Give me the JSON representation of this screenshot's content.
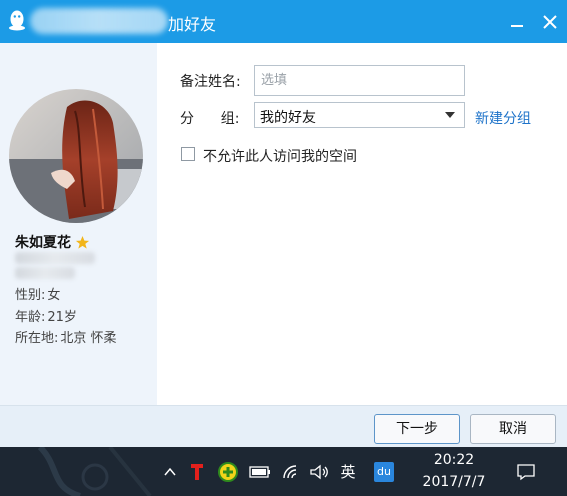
{
  "window": {
    "title": "加好友",
    "minimize_icon": "minimize-icon",
    "close_icon": "close-icon"
  },
  "profile": {
    "nickname": "朱如夏花",
    "gender_label": "性别:",
    "gender": "女",
    "age_label": "年龄:",
    "age": "21岁",
    "location_label": "所在地:",
    "location": "北京  怀柔"
  },
  "form": {
    "remark_label": "备注姓名:",
    "remark_placeholder": "选填",
    "remark_value": "",
    "group_label": "分      组:",
    "group_value": "我的好友",
    "new_group_link": "新建分组",
    "privacy_checkbox_label": "不允许此人访问我的空间",
    "privacy_checked": false
  },
  "buttons": {
    "next": "下一步",
    "cancel": "取消"
  },
  "taskbar": {
    "input_method": "英",
    "tray_app": "du",
    "time": "20:22",
    "date": "2017/7/7"
  },
  "colors": {
    "titlebar": "#1c9be6",
    "link": "#1e73c9",
    "left_panel": "#eef4fb",
    "taskbar": "#1d2733"
  }
}
